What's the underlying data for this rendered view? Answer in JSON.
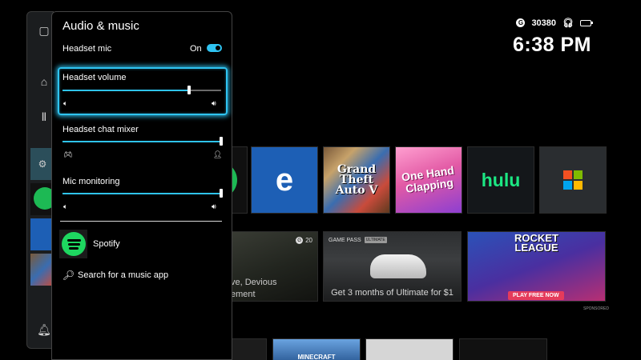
{
  "status": {
    "gamerscore": "30380",
    "time": "6:38 PM",
    "icons": [
      "gamerscore-icon",
      "headset-icon",
      "battery-icon"
    ]
  },
  "panel": {
    "title": "Audio & music",
    "headset_mic": {
      "label": "Headset mic",
      "state": "On",
      "on": true
    },
    "headset_volume": {
      "label": "Headset volume",
      "value_fraction": 0.8
    },
    "chat_mixer": {
      "label": "Headset chat mixer",
      "value_fraction": 1.0
    },
    "mic_monitoring": {
      "label": "Mic monitoring",
      "value_fraction": 1.0
    },
    "music_app": {
      "name": "Spotify"
    },
    "search": {
      "label": "Search for a music app"
    }
  },
  "background": {
    "tiles_row1": [
      "spotify-tile",
      "edge-tile",
      "gta-v-tile",
      "hatchet-tile",
      "hulu-tile",
      "store-tile"
    ],
    "gta_text": "Grand Theft Auto V",
    "hatchet_text": "One Hand Clapping",
    "hulu_text": "hulu",
    "edge_letter": "e",
    "devious_caption_1": "ve, Devious",
    "devious_caption_2": "ement",
    "devious_badge": "20",
    "gamepass_label": "GAME PASS",
    "gamepass_chip": "ULTIMATE",
    "gamepass_caption": "Get 3 months of Ultimate for $1",
    "rocket_title_1": "ROCKET",
    "rocket_title_2": "LEAGUE",
    "rocket_cta": "PLAY FREE NOW",
    "sponsored": "SPONSORED",
    "minecraft_text": "MINECRAFT"
  },
  "colors": {
    "accent": "#2fc4f2",
    "spotify": "#1ed760",
    "hulu": "#1ce783",
    "edge": "#1d5fb5"
  }
}
